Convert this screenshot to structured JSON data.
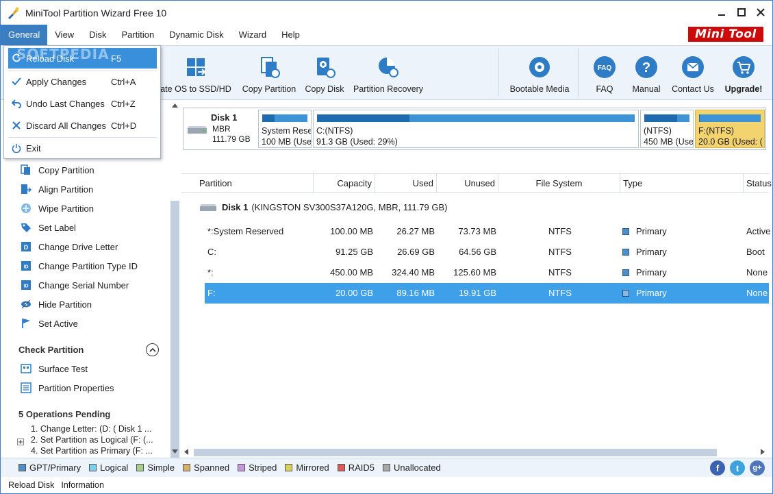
{
  "app": {
    "title": "MiniTool Partition Wizard Free 10",
    "logo_left": "Mini",
    "logo_right": "Tool"
  },
  "menubar": [
    {
      "label": "General",
      "active": true
    },
    {
      "label": "View"
    },
    {
      "label": "Disk"
    },
    {
      "label": "Partition"
    },
    {
      "label": "Dynamic Disk"
    },
    {
      "label": "Wizard"
    },
    {
      "label": "Help"
    }
  ],
  "toolbar": {
    "migrate": "ate OS to SSD/HD",
    "copy_partition": "Copy Partition",
    "copy_disk": "Copy Disk",
    "partition_recovery": "Partition Recovery",
    "bootable_media": "Bootable Media",
    "faq": "FAQ",
    "manual": "Manual",
    "contact_us": "Contact Us",
    "upgrade": "Upgrade!"
  },
  "general_menu": [
    {
      "label": "Reload Disk",
      "shortcut": "F5",
      "highlighted": true
    },
    {
      "label": "Apply Changes",
      "shortcut": "Ctrl+A"
    },
    {
      "label": "Undo Last Changes",
      "shortcut": "Ctrl+Z"
    },
    {
      "label": "Discard All Changes",
      "shortcut": "Ctrl+D"
    },
    {
      "label": "Exit",
      "shortcut": ""
    }
  ],
  "watermark": "SOFTPEDIA",
  "left_panel": {
    "partition_ops": [
      "Copy Partition",
      "Align Partition",
      "Wipe Partition",
      "Set Label",
      "Change Drive Letter",
      "Change Partition Type ID",
      "Change Serial Number",
      "Hide Partition",
      "Set Active"
    ],
    "check_partition": {
      "title": "Check Partition",
      "items": [
        "Surface Test",
        "Partition Properties"
      ]
    },
    "pending": {
      "title": "5 Operations Pending",
      "items": [
        "1. Change Letter: (D: ( Disk 1 ...",
        "2. Set Partition as Logical (F: (...",
        "4. Set Partition as Primary (F: ..."
      ]
    }
  },
  "disk_map": {
    "name": "Disk 1",
    "type": "MBR",
    "size": "111.79 GB",
    "segments": [
      {
        "name": "System Rese",
        "size": "100 MB (Use",
        "used_pct": 27,
        "selected": false
      },
      {
        "name": "C:(NTFS)",
        "size": "91.3 GB (Used: 29%)",
        "used_pct": 29,
        "selected": false
      },
      {
        "name": "(NTFS)",
        "size": "450 MB (Use",
        "used_pct": 72,
        "selected": false
      },
      {
        "name": "F:(NTFS)",
        "size": "20.0 GB (Used: (",
        "used_pct": 1,
        "selected": true
      }
    ]
  },
  "grid": {
    "columns": [
      "Partition",
      "Capacity",
      "Used",
      "Unused",
      "File System",
      "Type",
      "Status"
    ],
    "disk_row": {
      "name": "Disk 1",
      "detail": "(KINGSTON SV300S37A120G, MBR, 111.79 GB)"
    },
    "rows": [
      {
        "partition": "*:System Reserved",
        "capacity": "100.00 MB",
        "used": "26.27 MB",
        "unused": "73.73 MB",
        "fs": "NTFS",
        "type": "Primary",
        "status": "Active",
        "selected": false
      },
      {
        "partition": "C:",
        "capacity": "91.25 GB",
        "used": "26.69 GB",
        "unused": "64.56 GB",
        "fs": "NTFS",
        "type": "Primary",
        "status": "Boot",
        "selected": false
      },
      {
        "partition": "*:",
        "capacity": "450.00 MB",
        "used": "324.40 MB",
        "unused": "125.60 MB",
        "fs": "NTFS",
        "type": "Primary",
        "status": "None",
        "selected": false
      },
      {
        "partition": "F:",
        "capacity": "20.00 GB",
        "used": "89.16 MB",
        "unused": "19.91 GB",
        "fs": "NTFS",
        "type": "Primary",
        "status": "None",
        "selected": true
      }
    ]
  },
  "legend": [
    {
      "label": "GPT/Primary",
      "color": "#4f8ec7"
    },
    {
      "label": "Logical",
      "color": "#7cd0ec"
    },
    {
      "label": "Simple",
      "color": "#a6cf8a"
    },
    {
      "label": "Spanned",
      "color": "#d5b06b"
    },
    {
      "label": "Striped",
      "color": "#c795d9"
    },
    {
      "label": "Mirrored",
      "color": "#d9d25a"
    },
    {
      "label": "RAID5",
      "color": "#e05757"
    },
    {
      "label": "Unallocated",
      "color": "#a8a8a8"
    }
  ],
  "status_bar": {
    "left": "Reload Disk",
    "right": "Information"
  },
  "social": [
    {
      "name": "facebook",
      "glyph": "f",
      "color": "#3b63b0"
    },
    {
      "name": "twitter",
      "glyph": "t",
      "color": "#3ea2dc"
    },
    {
      "name": "google-plus",
      "glyph": "g+",
      "color": "#4f76bb"
    }
  ]
}
